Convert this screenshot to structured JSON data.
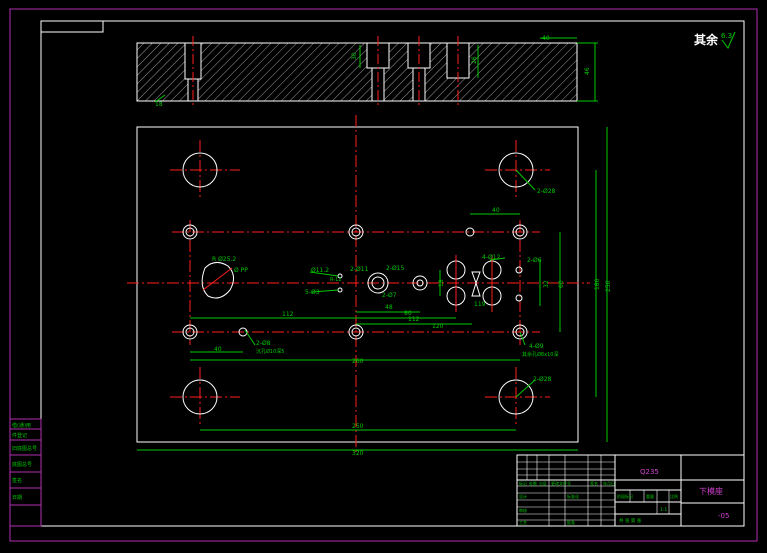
{
  "drawing": {
    "roughness_note_text": "其余",
    "roughness_value": "6.3",
    "top_view_dims": {
      "width_40": "40",
      "height_46": "46",
      "gap_30": "30",
      "gap_26": "26",
      "gap_18": "18"
    },
    "plan_dims": {
      "overall_width": "320",
      "center_span": "250",
      "length_260": "260",
      "height_250": "250",
      "height_180": "180",
      "height_60": "60",
      "height_32": "32",
      "height_18": "18",
      "d_40_top": "40",
      "d_40_bottom": "40",
      "d_112": "112",
      "d_48": "48",
      "d_80": "80",
      "d_112b": "112",
      "d_120": "120",
      "d_119": "119"
    },
    "hole_labels": {
      "big_hole_tr": "2-Ø28",
      "big_hole_br": "2-Ø28",
      "pin_label": "4-Ø12",
      "small_holes": "2-Ø6",
      "thread_left": "2-Ø8",
      "counterbore": "R Ø25.2",
      "counterbore_sub": "Ø PP",
      "pilot_a": "Ø11.2",
      "pilot_b": "5-Ø3",
      "pilot_c": "2-Ø11",
      "pilot_d": "2-Ø15",
      "pilot_e": "2-Ø7",
      "right_note_a": "4-Ø9",
      "right_note_b": "其余孔Ø8x10深",
      "left_note_a": "2-Ø8",
      "left_note_b": "沉孔Ø10深5",
      "r_label": "R-12"
    },
    "title_block": {
      "material": "Q235",
      "part_name": "下模座",
      "drawing_no": "-05",
      "scale_label": "1:1",
      "left_rows": [
        "标记",
        "处数",
        "分区",
        "更改文件号",
        "签名",
        "年月日"
      ],
      "row_design": "设计",
      "row_check": "审核",
      "row_process": "工艺",
      "row_standard": "标准化",
      "row_approve": "批准",
      "col_labels": [
        "阶段标记",
        "重量",
        "比例"
      ],
      "sheet_text": "共 张 第 张"
    },
    "side_table": [
      "借(通)用",
      "件登记",
      "旧底图总号",
      "底图总号",
      "签名",
      "日期"
    ]
  }
}
